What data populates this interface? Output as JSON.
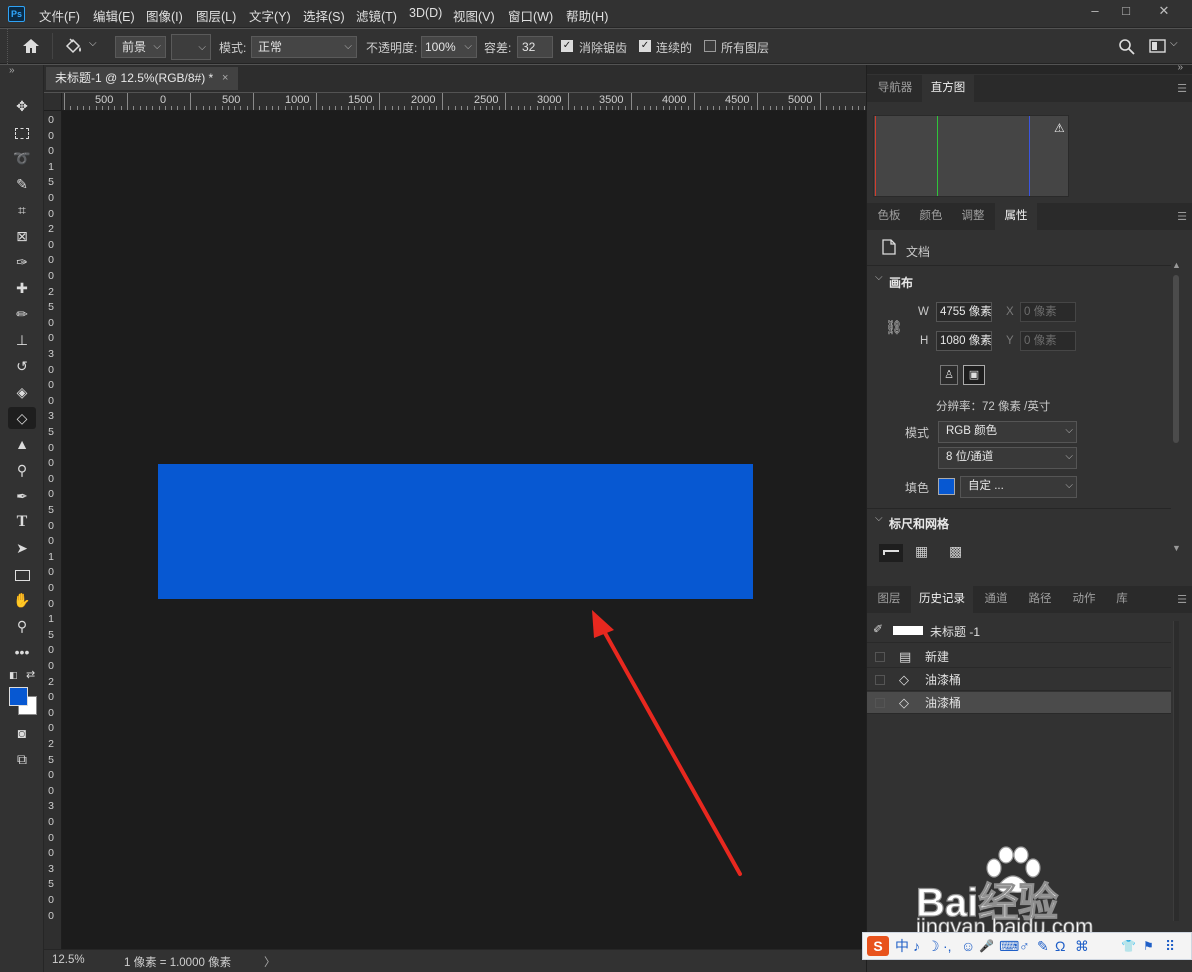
{
  "app": {
    "logo": "Ps"
  },
  "menu": [
    "文件(F)",
    "编辑(E)",
    "图像(I)",
    "图层(L)",
    "文字(Y)",
    "选择(S)",
    "滤镜(T)",
    "3D(D)",
    "视图(V)",
    "窗口(W)",
    "帮助(H)"
  ],
  "window_controls": [
    "–",
    "□",
    "✕"
  ],
  "options": {
    "home_icon": "home-icon",
    "tool_icon": "paint-bucket-icon",
    "source": "前景",
    "mode_label": "模式:",
    "mode_value": "正常",
    "opacity_label": "不透明度:",
    "opacity_value": "100%",
    "tolerance_label": "容差:",
    "tolerance_value": "32",
    "antialias_label": "消除锯齿",
    "antialias_checked": true,
    "contiguous_label": "连续的",
    "contiguous_checked": true,
    "all_layers_label": "所有图层",
    "all_layers_checked": false
  },
  "document": {
    "tab_title": "未标题-1 @ 12.5%(RGB/8#) *",
    "close": "×",
    "fill_color": "#0758d2",
    "canvas_bg": "#1c1c1c"
  },
  "ruler": {
    "top_labels": [
      "500",
      "0",
      "500",
      "1000",
      "1500",
      "2000",
      "2500",
      "3000",
      "3500",
      "4000",
      "4500",
      "5000"
    ],
    "left_labels": [
      "0",
      "0",
      "0",
      "1",
      "5",
      "0",
      "0",
      "2",
      "0",
      "0",
      "0",
      "2",
      "5",
      "0",
      "0",
      "3",
      "0",
      "0",
      "0",
      "3",
      "5",
      "0",
      "0",
      "0",
      "0",
      "5",
      "0",
      "0",
      "1",
      "0",
      "0",
      "0",
      "1",
      "5",
      "0",
      "0",
      "2",
      "0",
      "0",
      "0",
      "2",
      "5",
      "0",
      "0",
      "3",
      "0",
      "0",
      "0",
      "3",
      "5",
      "0",
      "0"
    ]
  },
  "status": {
    "zoom": "12.5%",
    "info": "1 像素 = 1.0000 像素",
    "arrow": "〉"
  },
  "panels": {
    "top_tabs": [
      "导航器",
      "直方图"
    ],
    "top_active": 1,
    "histogram_warning": "⚠",
    "mid_tabs": [
      "色板",
      "颜色",
      "调整",
      "属性"
    ],
    "mid_active": 3,
    "doc_label": "文档",
    "canvas_section": "画布",
    "w_label": "W",
    "w_value": "4755 像素",
    "h_label": "H",
    "h_value": "1080 像素",
    "x_label": "X",
    "x_value": "0 像素",
    "y_label": "Y",
    "y_value": "0 像素",
    "resolution": "分辨率：72 像素 /英寸",
    "mode_label": "模式",
    "mode_value": "RGB 颜色",
    "depth_value": "8 位/通道",
    "fill_label": "填色",
    "fill_value": "自定 ...",
    "fill_swatch": "#0758d2",
    "rulers_section": "标尺和网格",
    "bottom_tabs": [
      "图层",
      "历史记录",
      "通道",
      "路径",
      "动作",
      "库"
    ],
    "bottom_active": 1,
    "history_snapshot": "未标题 -1",
    "history": [
      {
        "label": "新建",
        "icon": "new-document-icon"
      },
      {
        "label": "油漆桶",
        "icon": "paint-bucket-icon"
      },
      {
        "label": "油漆桶",
        "icon": "paint-bucket-icon"
      }
    ],
    "history_active": 2
  },
  "watermark": {
    "text": "Bai经验",
    "url": "jingyan.baidu.com"
  },
  "ime": {
    "items": [
      "S",
      "中",
      "♪",
      "☽",
      "·,",
      "☺",
      "🎤",
      "⌨",
      "♂",
      "✎",
      "Ω",
      "⌘",
      "👕",
      "⚑",
      "⠿"
    ]
  }
}
